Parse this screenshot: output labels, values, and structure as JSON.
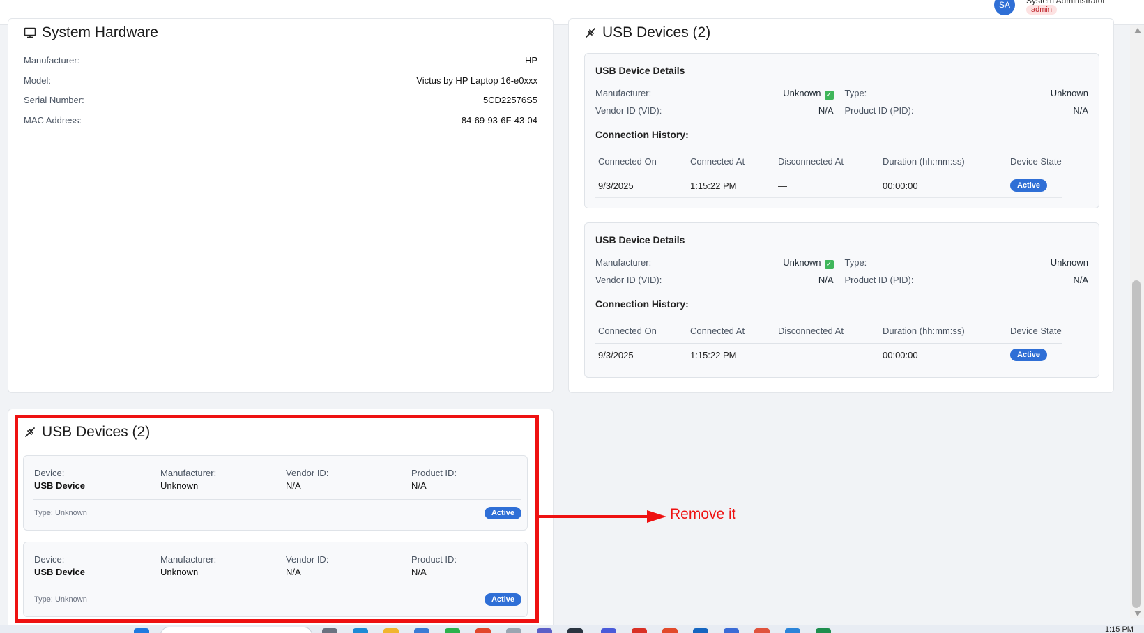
{
  "header": {
    "avatar_initials": "SA",
    "user_name": "System Administrator",
    "role": "admin"
  },
  "system_hardware": {
    "title": "System Hardware",
    "rows": [
      {
        "label": "Manufacturer:",
        "value": "HP"
      },
      {
        "label": "Model:",
        "value": "Victus by HP Laptop 16-e0xxx"
      },
      {
        "label": "Serial Number:",
        "value": "5CD22576S5"
      },
      {
        "label": "MAC Address:",
        "value": "84-69-93-6F-43-04"
      }
    ]
  },
  "usb_details_panel": {
    "title": "USB Devices (2)",
    "devices": [
      {
        "heading": "USB Device Details",
        "manufacturer_label": "Manufacturer:",
        "manufacturer_value": "Unknown",
        "type_label": "Type:",
        "type_value": "Unknown",
        "vid_label": "Vendor ID (VID):",
        "vid_value": "N/A",
        "pid_label": "Product ID (PID):",
        "pid_value": "N/A",
        "history_title": "Connection History:",
        "columns": [
          "Connected On",
          "Connected At",
          "Disconnected At",
          "Duration (hh:mm:ss)",
          "Device State"
        ],
        "row": {
          "connected_on": "9/3/2025",
          "connected_at": "1:15:22 PM",
          "disconnected_at": "—",
          "duration": "00:00:00",
          "state": "Active"
        }
      },
      {
        "heading": "USB Device Details",
        "manufacturer_label": "Manufacturer:",
        "manufacturer_value": "Unknown",
        "type_label": "Type:",
        "type_value": "Unknown",
        "vid_label": "Vendor ID (VID):",
        "vid_value": "N/A",
        "pid_label": "Product ID (PID):",
        "pid_value": "N/A",
        "history_title": "Connection History:",
        "columns": [
          "Connected On",
          "Connected At",
          "Disconnected At",
          "Duration (hh:mm:ss)",
          "Device State"
        ],
        "row": {
          "connected_on": "9/3/2025",
          "connected_at": "1:15:22 PM",
          "disconnected_at": "—",
          "duration": "00:00:00",
          "state": "Active"
        }
      }
    ]
  },
  "usb_summary_panel": {
    "title": "USB Devices (2)",
    "devices": [
      {
        "device_label": "Device:",
        "device_value": "USB Device",
        "manufacturer_label": "Manufacturer:",
        "manufacturer_value": "Unknown",
        "vendor_label": "Vendor ID:",
        "vendor_value": "N/A",
        "product_label": "Product ID:",
        "product_value": "N/A",
        "type_text": "Type: Unknown",
        "status": "Active"
      },
      {
        "device_label": "Device:",
        "device_value": "USB Device",
        "manufacturer_label": "Manufacturer:",
        "manufacturer_value": "Unknown",
        "vendor_label": "Vendor ID:",
        "vendor_value": "N/A",
        "product_label": "Product ID:",
        "product_value": "N/A",
        "type_text": "Type: Unknown",
        "status": "Active"
      }
    ]
  },
  "annotation": {
    "text": "Remove it",
    "color": "#ee1111"
  },
  "taskbar": {
    "clock": "1:15 PM"
  },
  "colors": {
    "accent": "#2f6fd6",
    "check_green": "#3fb65a"
  }
}
